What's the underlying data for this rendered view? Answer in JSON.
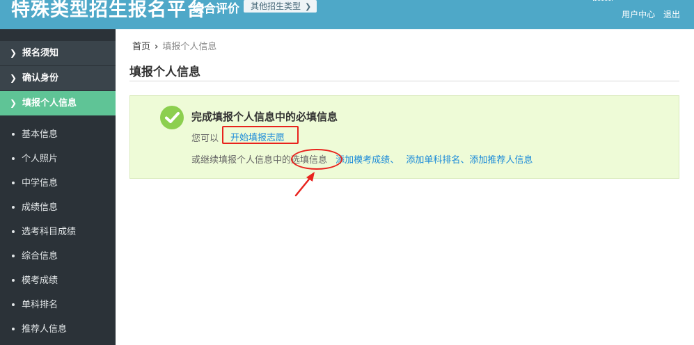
{
  "header": {
    "app_title": "特殊类型招生报名平台",
    "sub_title": "综合评价",
    "other_button": "其他招生类型",
    "user_center": "用户中心",
    "logout": "退出"
  },
  "sidebar": {
    "main_items": [
      {
        "label": "报名须知"
      },
      {
        "label": "确认身份"
      },
      {
        "label": "填报个人信息",
        "active": true
      }
    ],
    "sub_items": [
      {
        "label": "基本信息"
      },
      {
        "label": "个人照片"
      },
      {
        "label": "中学信息"
      },
      {
        "label": "成绩信息"
      },
      {
        "label": "选考科目成绩"
      },
      {
        "label": "综合信息"
      },
      {
        "label": "模考成绩"
      },
      {
        "label": "单科排名"
      },
      {
        "label": "推荐人信息"
      }
    ]
  },
  "breadcrumb": {
    "home": "首页",
    "current": "填报个人信息"
  },
  "page_title": "填报个人信息",
  "notice": {
    "title": "完成填报个人信息中的必填信息",
    "line1_prefix": "您可以",
    "start_link": "开始填报志愿",
    "line2_prefix": "或继续填报个人信息中的",
    "line2_highlight": "选填信息",
    "links": [
      "添加模考成绩",
      "添加单科排名",
      "添加推荐人信息"
    ],
    "separator_1": "、",
    "separator_2": "、"
  },
  "colors": {
    "header": "#4ea8c8",
    "sidebar": "#2b3238",
    "sidebar_active": "#5fc496",
    "notice_bg": "#eefbd7",
    "link": "#1a8ad8",
    "annotation_red": "#e8231d"
  }
}
